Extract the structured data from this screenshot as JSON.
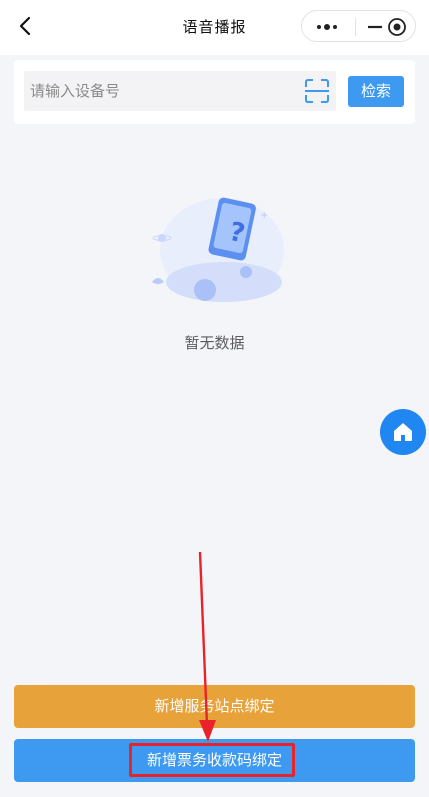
{
  "navbar": {
    "title": "语音播报",
    "back_icon": "chevron-left-icon",
    "capsule": {
      "more_icon": "dots-icon",
      "minimize_icon": "minus-icon",
      "close_icon": "target-icon"
    }
  },
  "search": {
    "placeholder": "请输入设备号",
    "scan_icon": "scan-icon",
    "button_label": "检索"
  },
  "empty_state": {
    "text": "暂无数据",
    "illustration": "phone-question-illustration"
  },
  "fab": {
    "icon": "home-icon"
  },
  "actions": {
    "bind_station_label": "新增服务站点绑定",
    "bind_ticket_code_label": "新增票务收款码绑定"
  },
  "colors": {
    "primary": "#3d9af0",
    "warning": "#e8a23a",
    "annotation": "#e8242a",
    "fab": "#1f86f2",
    "background": "#f4f5f9"
  }
}
